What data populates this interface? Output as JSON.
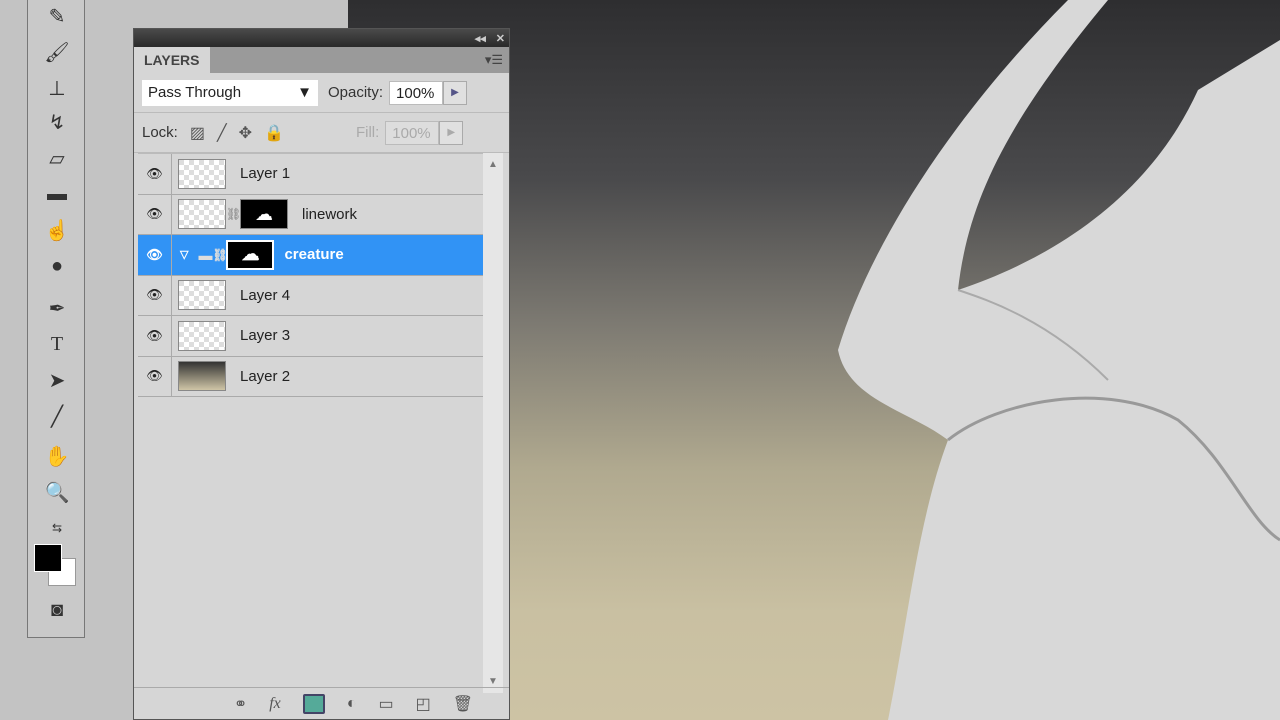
{
  "panel": {
    "tab": "LAYERS",
    "blend_mode": "Pass Through",
    "opacity_label": "Opacity:",
    "opacity": "100%",
    "lock_label": "Lock:",
    "fill_label": "Fill:",
    "fill": "100%"
  },
  "layers": [
    {
      "name": "Layer 1",
      "selected": false
    },
    {
      "name": "linework",
      "selected": false
    },
    {
      "name": "creature",
      "selected": true
    },
    {
      "name": "Layer 4",
      "selected": false
    },
    {
      "name": "Layer 3",
      "selected": false
    },
    {
      "name": "Layer 2",
      "selected": false
    }
  ]
}
